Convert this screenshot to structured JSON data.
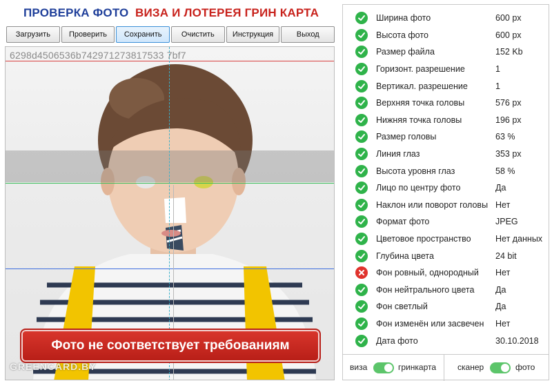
{
  "header": {
    "title_left": "ПРОВЕРКА ФОТО",
    "title_right": "ВИЗА И ЛОТЕРЕЯ ГРИН КАРТА"
  },
  "toolbar": {
    "buttons": [
      {
        "label": "Загрузить"
      },
      {
        "label": "Проверить"
      },
      {
        "label": "Сохранить"
      },
      {
        "label": "Очистить"
      },
      {
        "label": "Инструкция"
      },
      {
        "label": "Выход"
      }
    ]
  },
  "photo": {
    "hash": "6298d4506536b742971273817533 7bf7",
    "warning": "Фото не соответствует требованиям",
    "watermark": "GREENCARD.BY"
  },
  "results": {
    "rows": [
      {
        "label": "Ширина фото",
        "value": "600 px",
        "status": "ok"
      },
      {
        "label": "Высота фото",
        "value": "600 px",
        "status": "ok"
      },
      {
        "label": "Размер файла",
        "value": "152 Kb",
        "status": "ok"
      },
      {
        "label": "Горизонт. разрешение",
        "value": "1",
        "status": "ok"
      },
      {
        "label": "Вертикал. разрешение",
        "value": "1",
        "status": "ok"
      },
      {
        "label": "Верхняя точка головы",
        "value": "576 px",
        "status": "ok"
      },
      {
        "label": "Нижняя точка головы",
        "value": "196 px",
        "status": "ok"
      },
      {
        "label": "Размер головы",
        "value": "63 %",
        "status": "ok"
      },
      {
        "label": "Линия глаз",
        "value": "353 px",
        "status": "ok"
      },
      {
        "label": "Высота уровня глаз",
        "value": "58 %",
        "status": "ok"
      },
      {
        "label": "Лицо по центру фото",
        "value": "Да",
        "status": "ok"
      },
      {
        "label": "Наклон или поворот головы",
        "value": "Нет",
        "status": "ok"
      },
      {
        "label": "Формат фото",
        "value": "JPEG",
        "status": "ok"
      },
      {
        "label": "Цветовое пространство",
        "value": "Нет данных",
        "status": "ok"
      },
      {
        "label": "Глубина цвета",
        "value": "24 bit",
        "status": "ok"
      },
      {
        "label": "Фон ровный, однородный",
        "value": "Нет",
        "status": "bad"
      },
      {
        "label": "Фон нейтрального цвета",
        "value": "Да",
        "status": "ok"
      },
      {
        "label": "Фон светлый",
        "value": "Да",
        "status": "ok"
      },
      {
        "label": "Фон изменён или засвечен",
        "value": "Нет",
        "status": "ok"
      },
      {
        "label": "Дата фото",
        "value": "30.10.2018",
        "status": "ok"
      }
    ]
  },
  "toggles": {
    "left_off": "виза",
    "left_on": "гринкарта",
    "right_off": "сканер",
    "right_on": "фото"
  },
  "colors": {
    "ok": "#2fb34a",
    "bad": "#e0322c",
    "title_blue": "#1f3f9a",
    "title_red": "#c8221c",
    "warning_bg": "#c92a22",
    "line_top": "#d84040",
    "line_eyes": "#3cbf5c",
    "line_chin": "#3e6fe0",
    "line_center": "#3bb0c9"
  }
}
